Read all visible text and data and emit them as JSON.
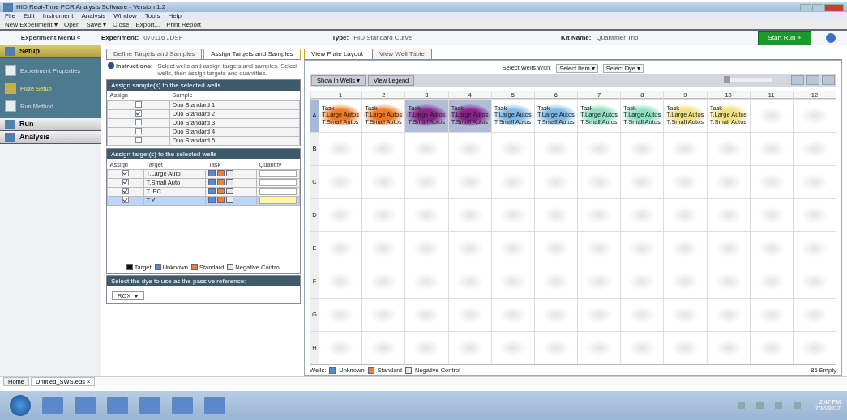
{
  "window": {
    "title": "HID Real-Time PCR Analysis Software - Version 1.2"
  },
  "menu": [
    "File",
    "Edit",
    "Instrument",
    "Analysis",
    "Window",
    "Tools",
    "Help"
  ],
  "toolbar": [
    "New Experiment ▾",
    "Open",
    "Save ▾",
    "Close",
    "Export...",
    "Print Report"
  ],
  "header": {
    "menu_label": "Experiment Menu «",
    "experiment_label": "Experiment:",
    "experiment_value": "070116 JDSF",
    "type_label": "Type:",
    "type_value": "HID Standard Curve",
    "kit_label": "Kit Name:",
    "kit_value": "Quantifiler Trio",
    "start_button": "Start Run »"
  },
  "sidebar": [
    {
      "label": "Setup",
      "kind": "section",
      "selected": true,
      "children": [
        {
          "label": "Experiment Properties",
          "selected": false
        },
        {
          "label": "Plate Setup",
          "selected": true
        },
        {
          "label": "Run Method",
          "selected": false
        }
      ]
    },
    {
      "label": "Run",
      "kind": "section",
      "selected": false
    },
    {
      "label": "Analysis",
      "kind": "section",
      "selected": false
    }
  ],
  "tabs": [
    {
      "label": "Define Targets and Samples",
      "selected": false
    },
    {
      "label": "Assign Targets and Samples",
      "selected": true
    }
  ],
  "instructions": {
    "label": "Instructions:",
    "text": "Select wells and assign targets and samples. Select wells, then assign targets and quantities."
  },
  "samples_panel": {
    "title": "Assign sample(s) to the selected wells",
    "columns": [
      "Assign",
      "Sample"
    ],
    "rows": [
      {
        "checked": false,
        "sample": "Duo Standard 1"
      },
      {
        "checked": true,
        "sample": "Duo Standard 2"
      },
      {
        "checked": false,
        "sample": "Duo Standard 3"
      },
      {
        "checked": false,
        "sample": "Duo Standard 4"
      },
      {
        "checked": false,
        "sample": "Duo Standard 5"
      }
    ]
  },
  "targets_panel": {
    "title": "Assign target(s) to the selected wells",
    "columns": [
      "Assign",
      "Target",
      "Task",
      "Quantity"
    ],
    "rows": [
      {
        "checked": true,
        "target": "T.Large Auto",
        "selected": false
      },
      {
        "checked": true,
        "target": "T.Small Auto",
        "selected": false
      },
      {
        "checked": true,
        "target": "T.IPC",
        "selected": false
      },
      {
        "checked": true,
        "target": "T.Y",
        "selected": true
      }
    ],
    "legend": [
      "Target",
      "Unknown",
      "Standard",
      "Negative Control"
    ]
  },
  "reference_panel": {
    "title": "Select the dye to use as the passive reference:",
    "value": "ROX"
  },
  "plate_tabs": [
    {
      "label": "View Plate Layout",
      "selected": true
    },
    {
      "label": "View Well Table",
      "selected": false
    }
  ],
  "select_bar": {
    "label": "Select Wells With:",
    "options": [
      "Select Item ▾",
      "Select Dye ▾"
    ]
  },
  "plate_toolbar": [
    "Show in Wells ▾",
    "View Legend"
  ],
  "zoom": {
    "level": 0
  },
  "plate": {
    "columns": [
      "1",
      "2",
      "3",
      "4",
      "5",
      "6",
      "7",
      "8",
      "9",
      "10",
      "11",
      "12"
    ],
    "rows": [
      {
        "label": "A",
        "wells": [
          {
            "kind": "assigned",
            "color": "#f07820",
            "selected": false,
            "lines": [
              "Task",
              "T.Large Autos",
              "T.Small Autos"
            ]
          },
          {
            "kind": "assigned",
            "color": "#f07820",
            "selected": false,
            "lines": [
              "Task",
              "T.Large Autos",
              "T.Small Autos"
            ]
          },
          {
            "kind": "assigned",
            "color": "#8a1f8a",
            "selected": true,
            "lines": [
              "Task",
              "T.Large Autos",
              "T.Small Autos"
            ]
          },
          {
            "kind": "assigned",
            "color": "#8a1f8a",
            "selected": true,
            "lines": [
              "Task",
              "T.Large Autos",
              "T.Small Autos"
            ]
          },
          {
            "kind": "assigned",
            "color": "#7ab8e8",
            "selected": false,
            "lines": [
              "Task",
              "T.Large Autos",
              "T.Small Autos"
            ]
          },
          {
            "kind": "assigned",
            "color": "#7ab8e8",
            "selected": false,
            "lines": [
              "Task",
              "T.Large Autos",
              "T.Small Autos"
            ]
          },
          {
            "kind": "assigned",
            "color": "#8ae0c0",
            "selected": false,
            "lines": [
              "Task",
              "T.Large Autos",
              "T.Small Autos"
            ]
          },
          {
            "kind": "assigned",
            "color": "#8ae0c0",
            "selected": false,
            "lines": [
              "Task",
              "T.Large Autos",
              "T.Small Autos"
            ]
          },
          {
            "kind": "assigned",
            "color": "#f0e080",
            "selected": false,
            "lines": [
              "Task",
              "T.Large Autos",
              "T.Small Autos"
            ]
          },
          {
            "kind": "assigned",
            "color": "#f0e080",
            "selected": false,
            "lines": [
              "Task",
              "T.Large Autos",
              "T.Small Autos"
            ]
          },
          {
            "kind": "empty",
            "selected": false
          },
          {
            "kind": "empty",
            "selected": false
          }
        ]
      },
      {
        "label": "B"
      },
      {
        "label": "C"
      },
      {
        "label": "D"
      },
      {
        "label": "E"
      },
      {
        "label": "F"
      },
      {
        "label": "G"
      },
      {
        "label": "H"
      }
    ]
  },
  "plate_legend": [
    "Wells:",
    "Unknown",
    "Standard",
    "Negative Control"
  ],
  "plate_status": "86 Empty",
  "status_tabs": [
    {
      "label": "Home",
      "selected": false
    },
    {
      "label": "Untitled_SWS.eds ×",
      "selected": true
    }
  ],
  "clock": {
    "time": "2:47 PM",
    "date": "7/14/2017"
  }
}
